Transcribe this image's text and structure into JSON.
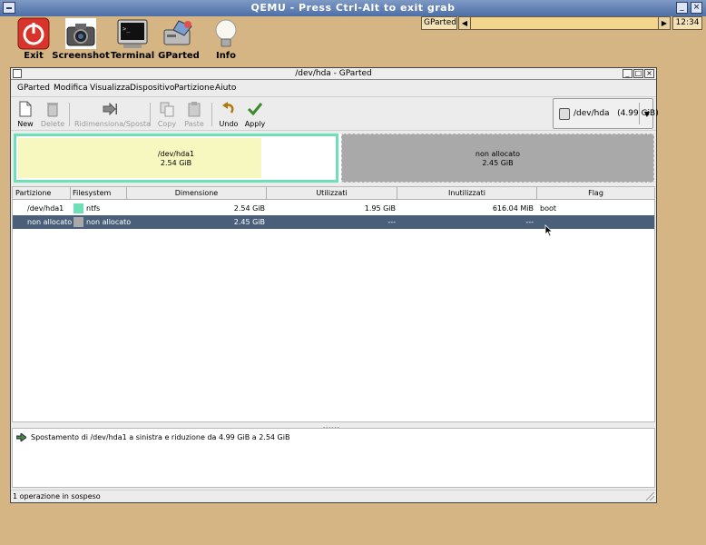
{
  "qemu": {
    "title": "QEMU - Press Ctrl-Alt to exit grab"
  },
  "launchers": [
    {
      "label": "Exit",
      "icon": "power-icon"
    },
    {
      "label": "Screenshot",
      "icon": "camera-icon"
    },
    {
      "label": "Terminal",
      "icon": "terminal-icon"
    },
    {
      "label": "GParted",
      "icon": "gparted-icon"
    },
    {
      "label": "Info",
      "icon": "lightbulb-icon"
    }
  ],
  "taskbar": {
    "task_label": "GParted",
    "clock": "12:34"
  },
  "window": {
    "title": "/dev/hda - GParted"
  },
  "menu": [
    "GParted",
    "Modifica",
    "Visualizza",
    "Dispositivo",
    "Partizione",
    "Aiuto"
  ],
  "toolbar": {
    "new": "New",
    "delete": "Delete",
    "resize_move": "Ridimensiona/Sposta",
    "copy": "Copy",
    "paste": "Paste",
    "undo": "Undo",
    "apply": "Apply"
  },
  "device": {
    "name": "/dev/hda",
    "size": "(4.99 GiB)"
  },
  "map": {
    "p1": {
      "name": "/dev/hda1",
      "size": "2.54 GiB",
      "used_fraction": 0.76,
      "color": "#6de0b8"
    },
    "p2": {
      "name": "non allocato",
      "size": "2.45 GiB",
      "color": "#a9a9a9"
    }
  },
  "table": {
    "columns": [
      "Partizione",
      "Filesystem",
      "Dimensione",
      "Utilizzati",
      "Inutilizzati",
      "Flag"
    ],
    "rows": [
      {
        "partition": "/dev/hda1",
        "filesystem": "ntfs",
        "fs_color": "#6de0b8",
        "size": "2.54 GiB",
        "used": "1.95 GiB",
        "unused": "616.04 MiB",
        "flag": "boot",
        "selected": false
      },
      {
        "partition": "non allocato",
        "filesystem": "non allocato",
        "fs_color": "#a9a9a9",
        "size": "2.45 GiB",
        "used": "---",
        "unused": "---",
        "flag": "",
        "selected": true
      }
    ]
  },
  "operations": [
    "Spostamento di /dev/hda1 a sinistra e riduzione da 4.99 GiB a 2.54 GiB"
  ],
  "status": "1 operazione in sospeso",
  "colors": {
    "desktop": "#d5b583",
    "selection": "#4a5f7a",
    "ntfs": "#6de0b8",
    "unallocated": "#a9a9a9"
  }
}
